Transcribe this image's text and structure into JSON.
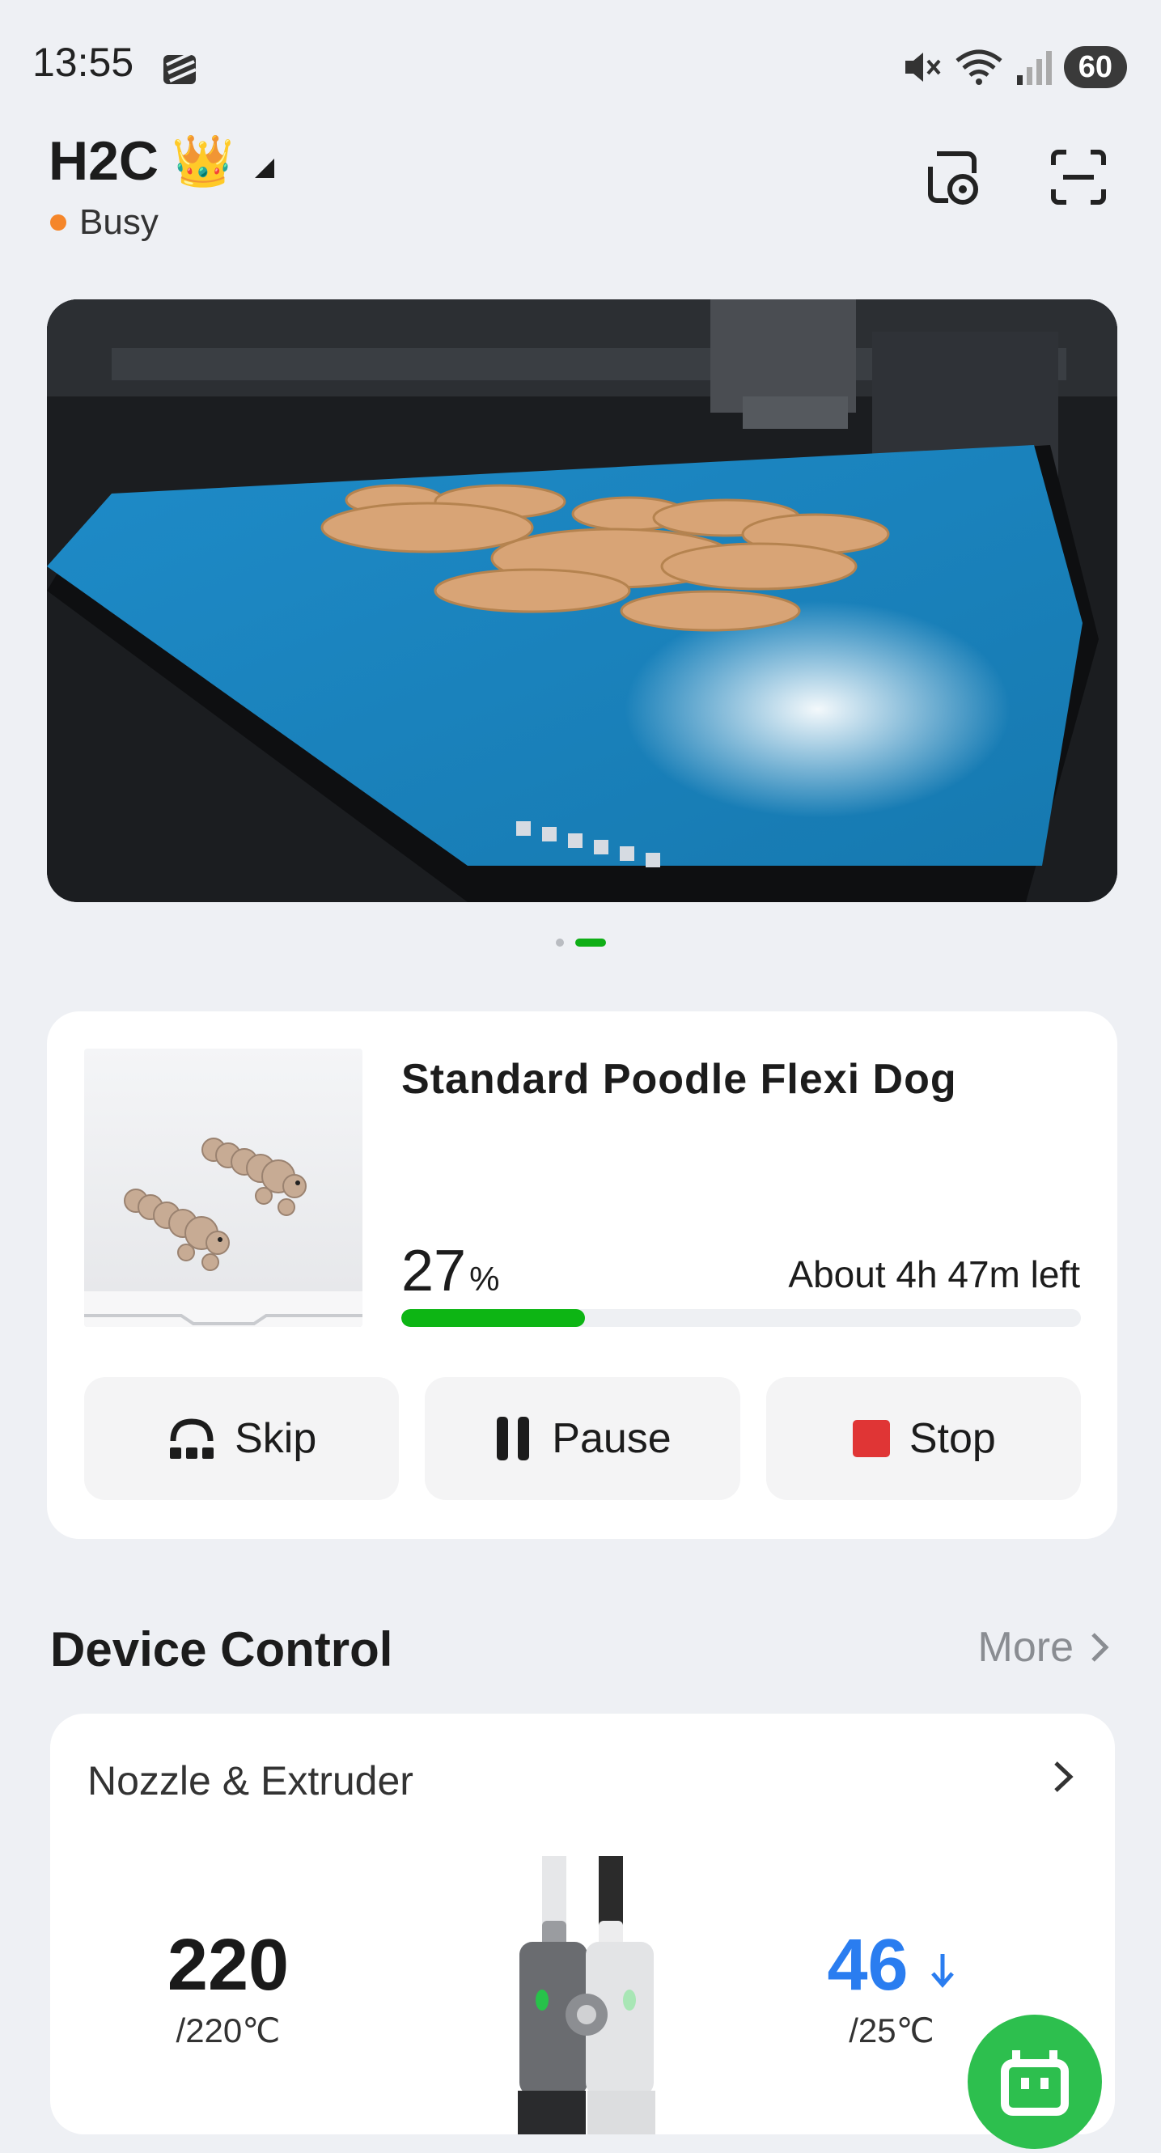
{
  "status_bar": {
    "time": "13:55",
    "battery": "60",
    "icons": [
      "mute-icon",
      "wifi-icon",
      "signal-icon"
    ]
  },
  "header": {
    "device_name": "H2C",
    "crown": "👑",
    "status_text": "Busy",
    "status_color": "#f5862a"
  },
  "camera": {
    "pages": 2,
    "active_page": 2
  },
  "job": {
    "title": "Standard Poodle Flexi Dog",
    "progress_value": "27",
    "progress_unit": "%",
    "progress_fraction": 0.27,
    "time_left": "About 4h 47m left",
    "actions": {
      "skip": "Skip",
      "pause": "Pause",
      "stop": "Stop"
    }
  },
  "device_control": {
    "title": "Device Control",
    "more": "More",
    "nozzle": {
      "title": "Nozzle & Extruder",
      "left_temp": "220",
      "left_target": "/220℃",
      "right_temp": "46",
      "right_target": "/25℃",
      "right_color": "#2a7df0"
    }
  },
  "colors": {
    "accent_green": "#0db514",
    "stop_red": "#e03535"
  }
}
